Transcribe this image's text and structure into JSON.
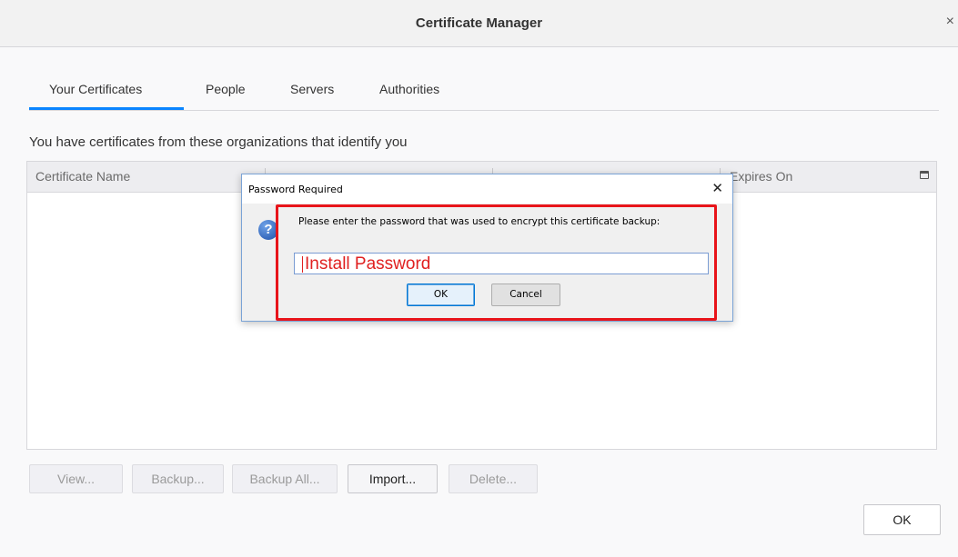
{
  "window": {
    "title": "Certificate Manager",
    "close_glyph": "×"
  },
  "tabs": [
    {
      "label": "Your Certificates",
      "selected": true
    },
    {
      "label": "People",
      "selected": false
    },
    {
      "label": "Servers",
      "selected": false
    },
    {
      "label": "Authorities",
      "selected": false
    }
  ],
  "description": "You have certificates from these organizations that identify you",
  "table": {
    "columns": [
      "Certificate Name",
      "",
      "",
      "Expires On"
    ],
    "rows": []
  },
  "buttons": {
    "view": "View...",
    "backup": "Backup...",
    "backup_all": "Backup All...",
    "import": "Import...",
    "delete": "Delete...",
    "ok": "OK"
  },
  "dialog": {
    "title": "Password Required",
    "close_glyph": "✕",
    "message": "Please enter the password that was used to encrypt this certificate backup:",
    "password_value": "Install Password",
    "ok_label": "OK",
    "cancel_label": "Cancel",
    "icon": "question-icon"
  },
  "colors": {
    "accent": "#0a84ff",
    "highlight": "#e8141a"
  }
}
